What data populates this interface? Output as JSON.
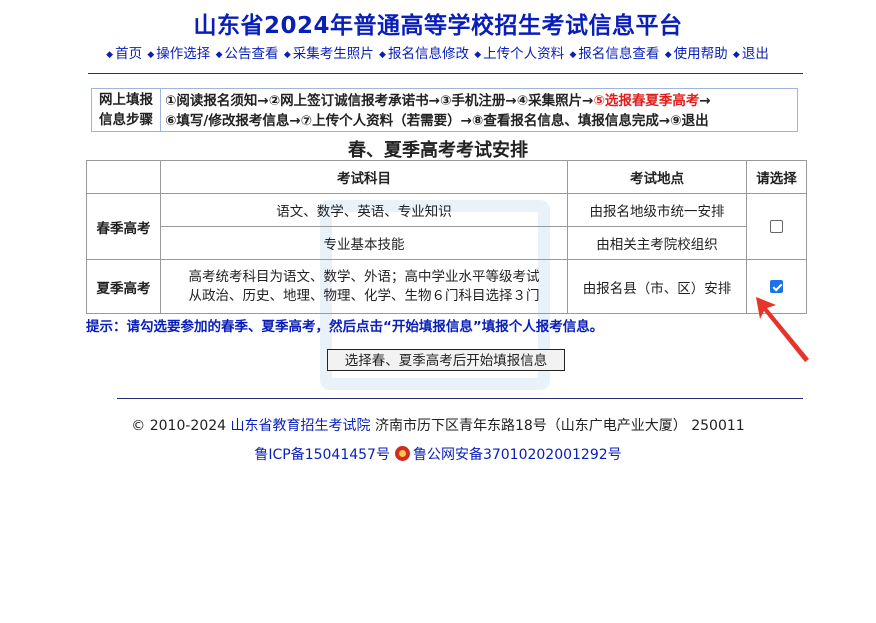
{
  "header": {
    "title": "山东省2024年普通高等学校招生考试信息平台",
    "nav": [
      {
        "label": "首页"
      },
      {
        "label": "操作选择"
      },
      {
        "label": "公告查看"
      },
      {
        "label": "采集考生照片"
      },
      {
        "label": "报名信息修改"
      },
      {
        "label": "上传个人资料"
      },
      {
        "label": "报名信息查看"
      },
      {
        "label": "使用帮助"
      },
      {
        "label": "退出"
      }
    ]
  },
  "steps": {
    "label_line1": "网上填报",
    "label_line2": "信息步骤",
    "line1_pre": "①阅读报名须知→②网上签订诚信报考承诺书→③手机注册→④采集照片→",
    "line1_highlight": "⑤选报春夏季高考",
    "line1_post": "→",
    "line2": "⑥填写/修改报考信息→⑦上传个人资料（若需要）→⑧查看报名信息、填报信息完成→⑨退出"
  },
  "schedule": {
    "title": "春、夏季高考考试安排",
    "headers": {
      "subject": "考试科目",
      "location": "考试地点",
      "select": "请选择"
    },
    "spring": {
      "season": "春季高考",
      "row1_subject": "语文、数学、英语、专业知识",
      "row1_location": "由报名地级市统一安排",
      "row2_subject": "专业基本技能",
      "row2_location": "由相关主考院校组织",
      "checked": false
    },
    "summer": {
      "season": "夏季高考",
      "subject_line1": "高考统考科目为语文、数学、外语；高中学业水平等级考试",
      "subject_line2": "从政治、历史、地理、物理、化学、生物６门科目选择３门",
      "location": "由报名县（市、区）安排",
      "checked": true
    }
  },
  "tip": "提示：请勾选要参加的春季、夏季高考，然后点击“开始填报信息”填报个人报考信息。",
  "start_button": "选择春、夏季高考后开始填报信息",
  "footer": {
    "copyright": "© 2010-2024 ",
    "org": "山东省教育招生考试院",
    "address": " 济南市历下区青年东路18号（山东广电产业大厦） 250011",
    "icp": "鲁ICP备15041457号",
    "police": "鲁公网安备37010202001292号"
  },
  "colors": {
    "link": "#0a1fb8",
    "highlight": "#e02020",
    "annotation_arrow": "#e8332a",
    "checkbox": "#1a73e8"
  }
}
